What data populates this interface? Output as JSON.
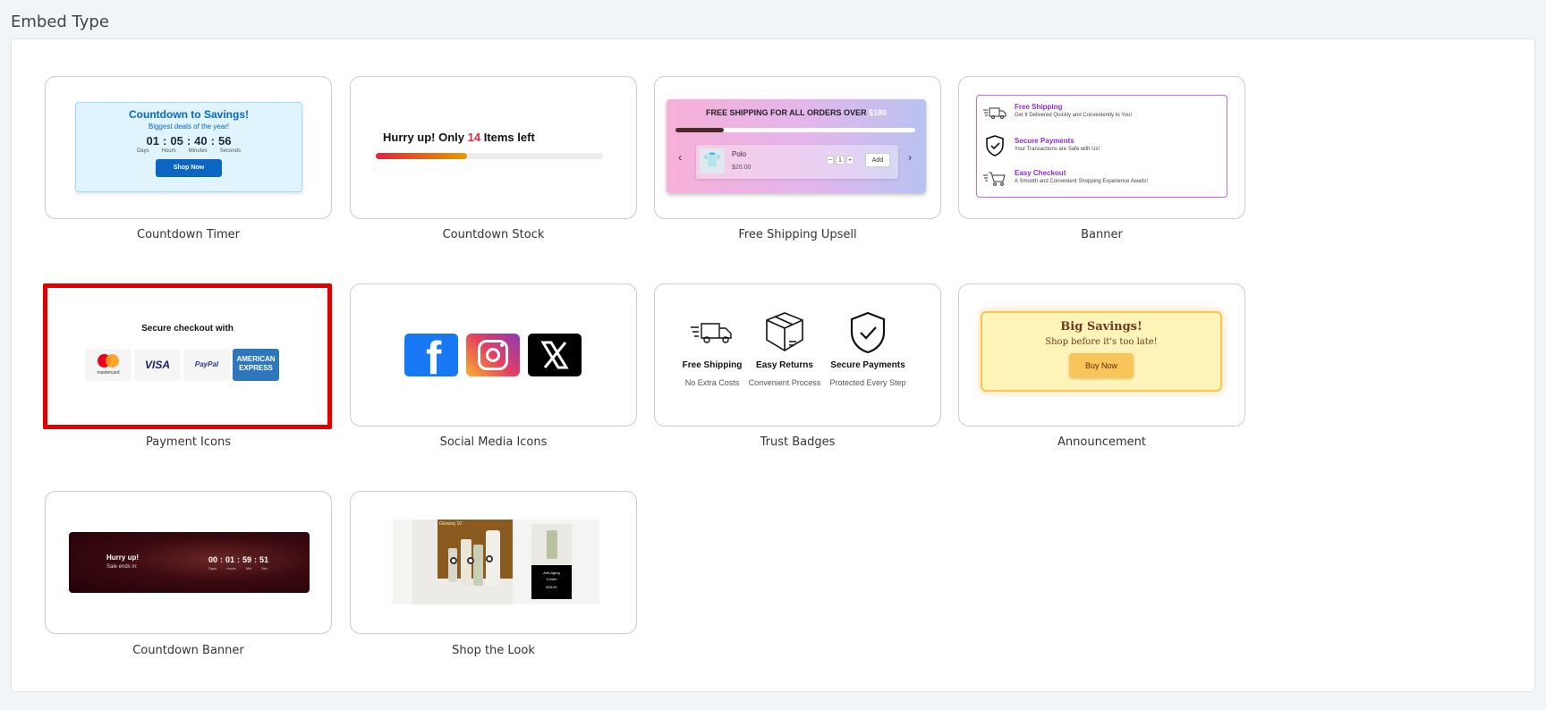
{
  "page": {
    "title": "Embed Type"
  },
  "cards": {
    "countdown_timer": {
      "label": "Countdown Timer",
      "preview": {
        "title": "Countdown to Savings!",
        "subtitle": "Biggest deals of the year!",
        "days": "01",
        "hours": "05",
        "minutes": "40",
        "seconds": "56",
        "days_label": "Days",
        "hours_label": "Hours",
        "minutes_label": "Minutes",
        "seconds_label": "Seconds",
        "sep": ":",
        "button": "Shop Now"
      }
    },
    "countdown_stock": {
      "label": "Countdown Stock",
      "preview": {
        "text_before": "Hurry up! Only ",
        "count": "14",
        "text_after": " Items left",
        "progress": 0.4
      }
    },
    "free_shipping_upsell": {
      "label": "Free Shipping Upsell",
      "preview": {
        "headline": "FREE SHIPPING FOR ALL ORDERS OVER ",
        "amount": "$180",
        "progress": 0.2,
        "product_name": "Polo",
        "price": "$20.00",
        "minus": "−",
        "qty": "1",
        "plus": "+",
        "add": "Add",
        "prev": "‹",
        "next": "›"
      }
    },
    "banner": {
      "label": "Banner",
      "preview": {
        "items": [
          {
            "title": "Free Shipping",
            "desc": "Get It Delivered Quickly and Conveniently to You!",
            "icon": "truck-icon"
          },
          {
            "title": "Secure Payments",
            "desc": "Your Transactions are Safe with Us!",
            "icon": "shield-check-icon"
          },
          {
            "title": "Easy Checkout",
            "desc": "A Smooth and Convenient Shopping Experience Awaits!",
            "icon": "cart-icon"
          }
        ],
        "accent": "#8a2be2"
      }
    },
    "payment_icons": {
      "label": "Payment Icons",
      "preview": {
        "title": "Secure checkout with",
        "mastercard_text": "mastercard",
        "visa": "VISA",
        "paypal": "PayPal",
        "amex_line1": "AMERICAN",
        "amex_line2": "EXPRESS"
      }
    },
    "social_media_icons": {
      "label": "Social Media Icons",
      "preview": {
        "facebook_glyph": "f",
        "icons": [
          "facebook-icon",
          "instagram-icon",
          "x-icon"
        ]
      }
    },
    "trust_badges": {
      "label": "Trust Badges",
      "preview": {
        "items": [
          {
            "title": "Free Shipping",
            "desc": "No Extra Costs",
            "icon": "truck-icon"
          },
          {
            "title": "Easy Returns",
            "desc": "Convenient Process",
            "icon": "box-icon"
          },
          {
            "title": "Secure Payments",
            "desc": "Protected Every Step",
            "icon": "shield-check-icon"
          }
        ]
      }
    },
    "announcement": {
      "label": "Announcement",
      "preview": {
        "title": "Big Savings!",
        "subtitle": "Shop before it's too late!",
        "button": "Buy Now"
      }
    },
    "countdown_banner": {
      "label": "Countdown Banner",
      "preview": {
        "title": "Hurry up!",
        "subtitle": "Sale ends in:",
        "days": "00",
        "hours": "01",
        "minutes": "59",
        "seconds": "51",
        "sep": ":",
        "days_label": "Days",
        "hours_label": "Hours",
        "minutes_label": "Min",
        "seconds_label": "Sec"
      }
    },
    "shop_the_look": {
      "label": "Shop the Look",
      "preview": {
        "image_caption": "Glowing 10",
        "product_text_1": "Anti-Aging",
        "product_text_2": "Cream",
        "product_price": "$25.00"
      }
    }
  },
  "colors": {
    "selected_border": "#e00000",
    "timer_blue": "#0a66c2",
    "stock_red": "#e3233c",
    "stock_orange": "#e69b00",
    "banner_purple": "#8a2be2",
    "announce_bg": "#fff4b8",
    "announce_btn": "#f8c55a"
  }
}
